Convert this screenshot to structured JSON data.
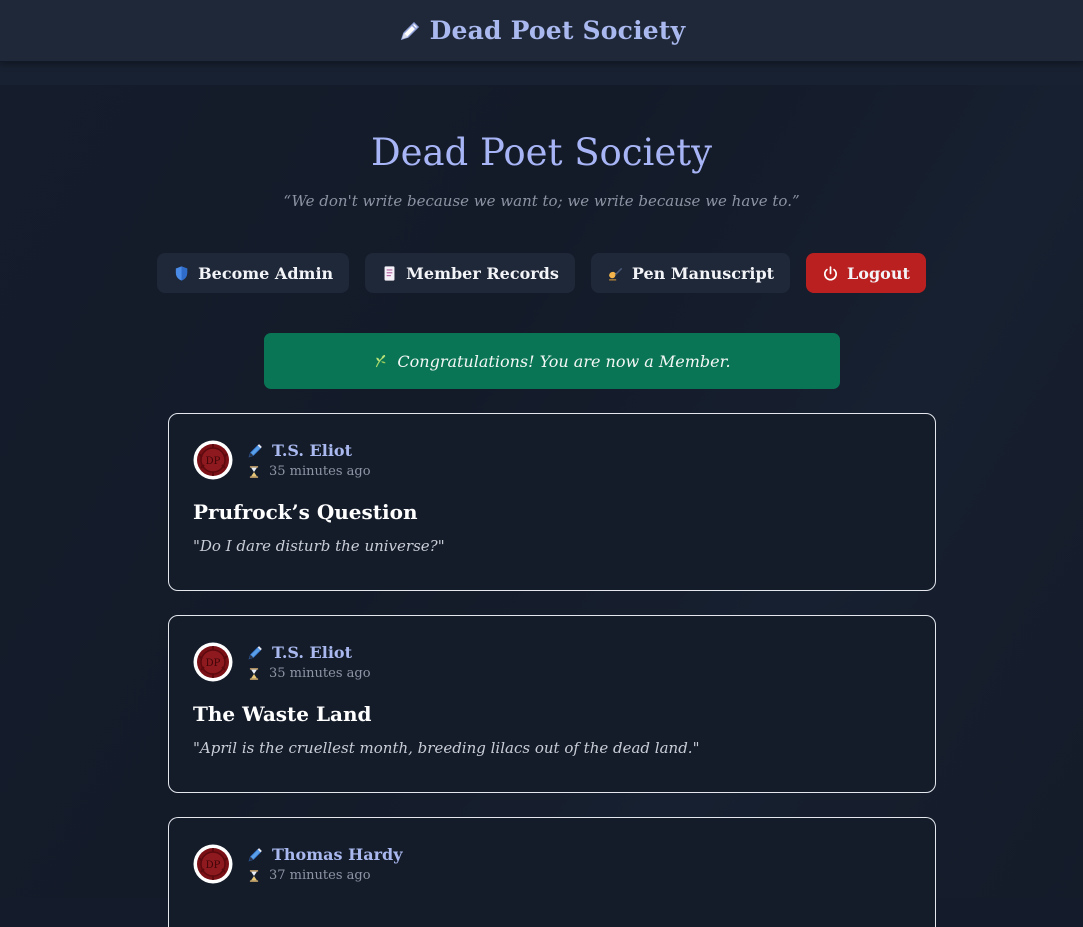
{
  "header": {
    "title": "Dead Poet Society",
    "icon": "pen-icon"
  },
  "hero": {
    "title": "Dead Poet Society",
    "quote": "“We don't write because we want to; we write because we have to.”"
  },
  "nav": [
    {
      "label": "Become Admin",
      "icon": "shield-icon"
    },
    {
      "label": "Member Records",
      "icon": "document-icon"
    },
    {
      "label": "Pen Manuscript",
      "icon": "writing-hand-icon"
    },
    {
      "label": "Logout",
      "icon": "power-icon"
    }
  ],
  "notice": {
    "text": "Congratulations! You are now a Member.",
    "icon": "herb-icon"
  },
  "posts": [
    {
      "author": "T.S. Eliot",
      "time": "35 minutes ago",
      "title": "Prufrock’s Question",
      "body": "\"Do I dare disturb the universe?\""
    },
    {
      "author": "T.S. Eliot",
      "time": "35 minutes ago",
      "title": "The Waste Land",
      "body": "\"April is the cruellest month, breeding lilacs out of the dead land.\""
    },
    {
      "author": "Thomas Hardy",
      "time": "37 minutes ago",
      "title": "",
      "body": ""
    }
  ],
  "colors": {
    "background": "#141c2b",
    "topbar": "#1f2838",
    "accent": "#a7b4f5",
    "success": "#0a7555",
    "danger": "#bb2020"
  }
}
